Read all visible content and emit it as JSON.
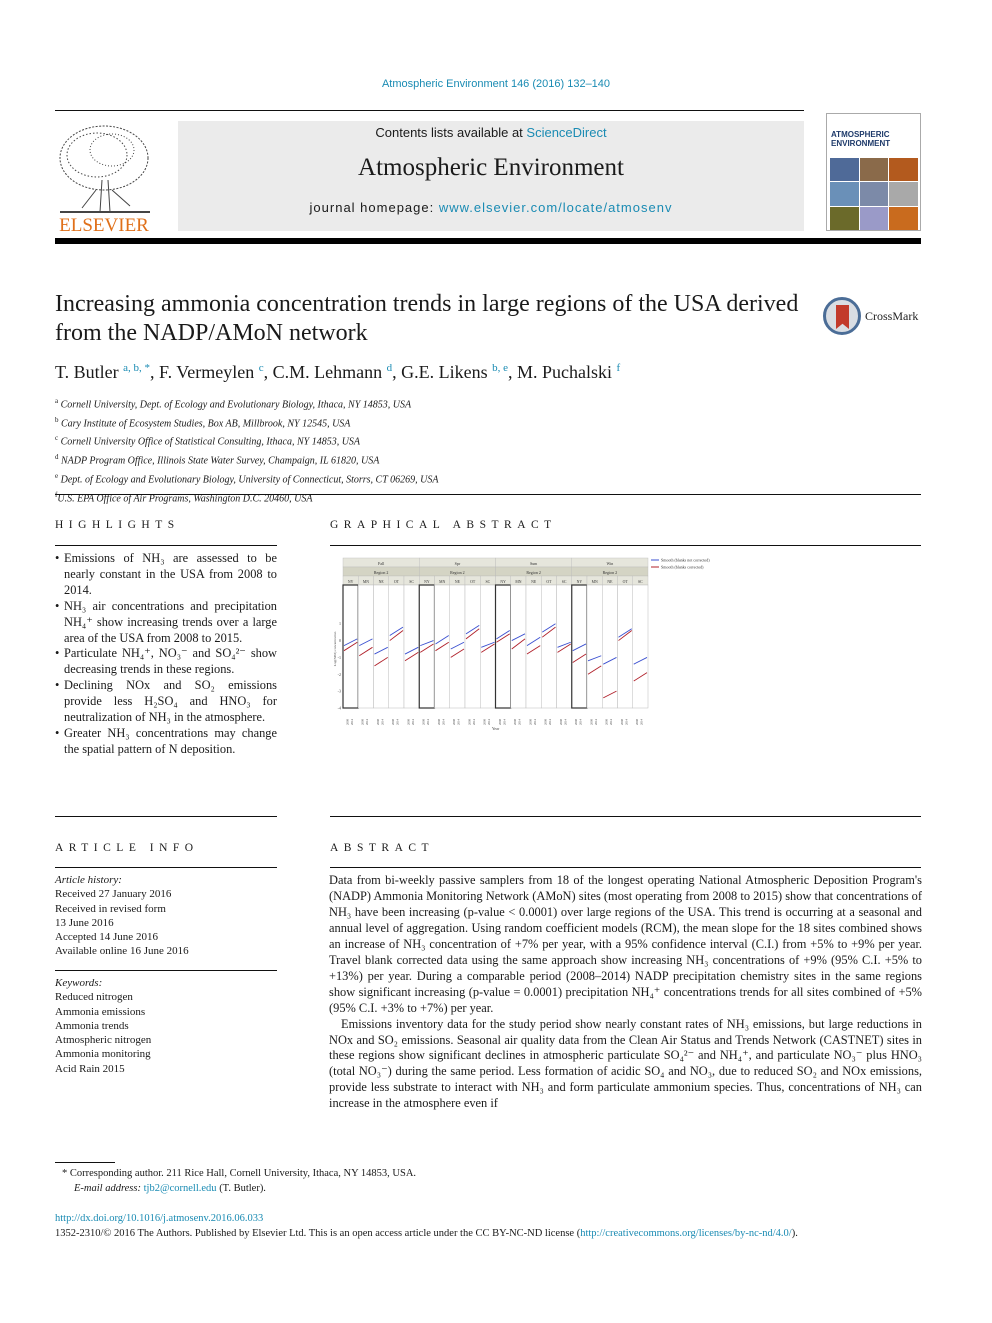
{
  "header": {
    "citation": "Atmospheric Environment 146 (2016) 132–140",
    "contents_prefix": "Contents lists available at ",
    "contents_link": "ScienceDirect",
    "journal_title": "Atmospheric Environment",
    "homepage_prefix": "journal homepage: ",
    "homepage_link": "www.elsevier.com/locate/atmosenv",
    "publisher_logo_text": "ELSEVIER",
    "cover_title_line1": "ATMOSPHERIC",
    "cover_title_line2": "ENVIRONMENT",
    "crossmark_label": "CrossMark"
  },
  "article": {
    "title": "Increasing ammonia concentration trends in large regions of the USA derived from the NADP/AMoN network",
    "authors": [
      {
        "name": "T. Butler",
        "sup": "a, b, *"
      },
      {
        "name": "F. Vermeylen",
        "sup": "c"
      },
      {
        "name": "C.M. Lehmann",
        "sup": "d"
      },
      {
        "name": "G.E. Likens",
        "sup": "b, e"
      },
      {
        "name": "M. Puchalski",
        "sup": "f"
      }
    ],
    "affiliations": [
      {
        "key": "a",
        "text": "Cornell University, Dept. of Ecology and Evolutionary Biology, Ithaca, NY 14853, USA"
      },
      {
        "key": "b",
        "text": "Cary Institute of Ecosystem Studies, Box AB, Millbrook, NY 12545, USA"
      },
      {
        "key": "c",
        "text": "Cornell University Office of Statistical Consulting, Ithaca, NY 14853, USA"
      },
      {
        "key": "d",
        "text": "NADP Program Office, Illinois State Water Survey, Champaign, IL 61820, USA"
      },
      {
        "key": "e",
        "text": "Dept. of Ecology and Evolutionary Biology, University of Connecticut, Storrs, CT 06269, USA"
      },
      {
        "key": "f",
        "text": "U.S. EPA Office of Air Programs, Washington D.C. 20460, USA"
      }
    ]
  },
  "highlights": {
    "heading": "Highlights",
    "items": [
      "Emissions of NH₃ are assessed to be nearly constant in the USA from 2008 to 2014.",
      "NH₃ air concentrations and precipitation NH₄⁺ show increasing trends over a large area of the USA from 2008 to 2015.",
      "Particulate NH₄⁺, NO₃⁻ and SO₄²⁻ show decreasing trends in these regions.",
      "Declining NOx and SO₂ emissions provide less H₂SO₄ and HNO₃ for neutralization of NH₃ in the atmosphere.",
      "Greater NH₃ concentrations may change the spatial pattern of N deposition."
    ]
  },
  "graphical_abstract": {
    "heading": "Graphical abstract",
    "chart_data": {
      "type": "line",
      "title": "",
      "xlabel": "Year",
      "ylabel": "Log(NH3) concentration",
      "seasons": [
        "Fall",
        "Spr",
        "Sum",
        "Win"
      ],
      "region_label": "Region 2",
      "sites": [
        "NY",
        "MN",
        "NE",
        "OT",
        "SC"
      ],
      "x_ticks": [
        "2008",
        "2014"
      ],
      "legend": [
        {
          "name": "Smooth (blanks not corrected)",
          "color": "#3a4fd0"
        },
        {
          "name": "Smooth (blanks corrected)",
          "color": "#b0202a"
        }
      ],
      "legend_position": "top-right",
      "ylim": [
        -4,
        3
      ],
      "yticks": [
        -4,
        -3,
        -2,
        -1,
        0,
        1
      ],
      "series": [
        {
          "name": "Smooth (blanks not corrected)",
          "segments": [
            [
              -0.3,
              0.1
            ],
            [
              -0.3,
              0.1
            ],
            [
              -0.8,
              -0.4
            ],
            [
              0.3,
              0.8
            ],
            [
              -0.8,
              -0.4
            ],
            [
              -0.3,
              0.0
            ],
            [
              -0.2,
              0.3
            ],
            [
              -0.5,
              -0.1
            ],
            [
              0.4,
              0.9
            ],
            [
              -0.4,
              -0.1
            ],
            [
              0.1,
              0.6
            ],
            [
              0.0,
              0.4
            ],
            [
              -0.3,
              0.2
            ],
            [
              0.5,
              1.0
            ],
            [
              -0.4,
              -0.1
            ],
            [
              -0.6,
              -0.2
            ],
            [
              -1.2,
              -0.9
            ],
            [
              -1.4,
              -1.0
            ],
            [
              0.2,
              0.7
            ],
            [
              -1.4,
              -1.0
            ]
          ]
        },
        {
          "name": "Smooth (blanks corrected)",
          "segments": [
            [
              -0.6,
              -0.1
            ],
            [
              -0.9,
              -0.4
            ],
            [
              -1.5,
              -1.0
            ],
            [
              0.0,
              0.6
            ],
            [
              -1.2,
              -0.7
            ],
            [
              -0.7,
              -0.2
            ],
            [
              -0.6,
              -0.1
            ],
            [
              -1.0,
              -0.5
            ],
            [
              0.1,
              0.7
            ],
            [
              -0.7,
              -0.2
            ],
            [
              -0.1,
              0.4
            ],
            [
              -0.5,
              0.1
            ],
            [
              -0.8,
              -0.3
            ],
            [
              0.2,
              0.8
            ],
            [
              -0.7,
              -0.2
            ],
            [
              -1.3,
              -0.8
            ],
            [
              -2.0,
              -1.5
            ],
            [
              -3.4,
              -3.0
            ],
            [
              0.0,
              0.6
            ],
            [
              -2.4,
              -1.9
            ]
          ]
        }
      ]
    }
  },
  "article_info": {
    "heading": "Article info",
    "history_label": "Article history:",
    "history": [
      "Received 27 January 2016",
      "Received in revised form",
      "13 June 2016",
      "Accepted 14 June 2016",
      "Available online 16 June 2016"
    ],
    "keywords_label": "Keywords:",
    "keywords": [
      "Reduced nitrogen",
      "Ammonia emissions",
      "Ammonia trends",
      "Atmospheric nitrogen",
      "Ammonia monitoring",
      "Acid Rain 2015"
    ]
  },
  "abstract": {
    "heading": "Abstract",
    "paragraphs": [
      "Data from bi-weekly passive samplers from 18 of the longest operating National Atmospheric Deposition Program's (NADP) Ammonia Monitoring Network (AMoN) sites (most operating from 2008 to 2015) show that concentrations of NH₃ have been increasing (p-value < 0.0001) over large regions of the USA. This trend is occurring at a seasonal and annual level of aggregation. Using random coefficient models (RCM), the mean slope for the 18 sites combined shows an increase of NH₃ concentration of +7% per year, with a 95% confidence interval (C.I.) from +5% to +9% per year. Travel blank corrected data using the same approach show increasing NH₃ concentrations of +9% (95% C.I. +5% to +13%) per year. During a comparable period (2008–2014) NADP precipitation chemistry sites in the same regions show significant increasing (p-value = 0.0001) precipitation NH₄⁺ concentrations trends for all sites combined of +5% (95% C.I. +3% to +7%) per year.",
      "Emissions inventory data for the study period show nearly constant rates of NH₃ emissions, but large reductions in NOx and SO₂ emissions. Seasonal air quality data from the Clean Air Status and Trends Network (CASTNET) sites in these regions show significant declines in atmospheric particulate SO₄²⁻ and NH₄⁺, and particulate NO₃⁻ plus HNO₃ (total NO₃⁻) during the same period. Less formation of acidic SO₄ and NO₃, due to reduced SO₂ and NOx emissions, provide less substrate to interact with NH₃ and form particulate ammonium species. Thus, concentrations of NH₃ can increase in the atmosphere even if"
    ]
  },
  "footnotes": {
    "corresponding": "* Corresponding author. 211 Rice Hall, Cornell University, Ithaca, NY 14853, USA.",
    "email_label": "E-mail address: ",
    "email": "tjb2@cornell.edu",
    "email_suffix": " (T. Butler).",
    "doi_link": "http://dx.doi.org/10.1016/j.atmosenv.2016.06.033",
    "license_prefix": "1352-2310/© 2016 The Authors. Published by Elsevier Ltd. This is an open access article under the CC BY-NC-ND license (",
    "license_link": "http://creativecommons.org/licenses/by-nc-nd/4.0/",
    "license_suffix": ")."
  }
}
